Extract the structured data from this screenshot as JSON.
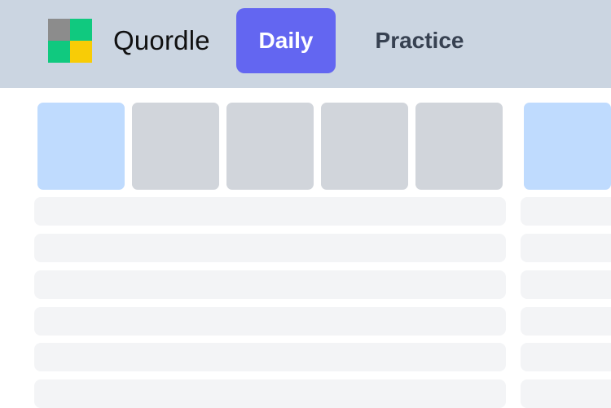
{
  "header": {
    "app_title": "Quordle",
    "tabs": [
      {
        "label": "Daily",
        "selected": true
      },
      {
        "label": "Practice",
        "selected": false
      }
    ],
    "logo_colors": [
      "#8c8c8c",
      "#10c97f",
      "#10c97f",
      "#f8cc06"
    ]
  },
  "game": {
    "current_row_tiles": [
      "",
      "",
      "",
      "",
      ""
    ],
    "empty_rows": 6
  },
  "colors": {
    "header_bg": "#cbd5e1",
    "accent": "#6366f1",
    "active_tile": "#bfdbfe",
    "tile": "#d1d5db",
    "row_bar": "#f3f4f6"
  }
}
